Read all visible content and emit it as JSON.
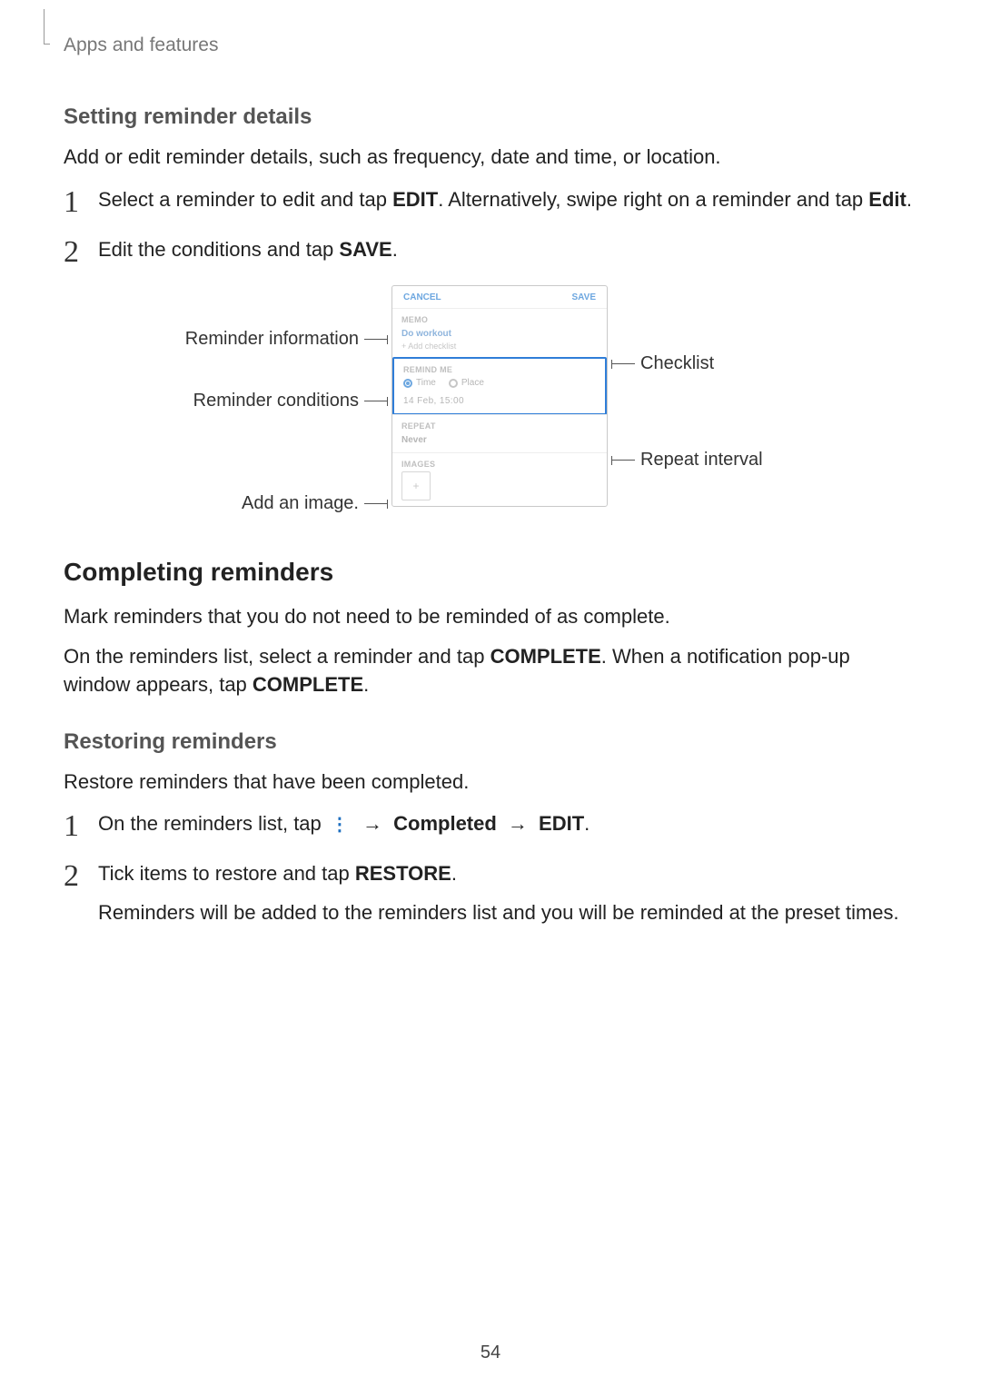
{
  "runningHead": "Apps and features",
  "pageNumber": "54",
  "s1": {
    "heading": "Setting reminder details",
    "intro": "Add or edit reminder details, such as frequency, date and time, or location.",
    "step1_a": "Select a reminder to edit and tap ",
    "step1_b": "EDIT",
    "step1_c": ". Alternatively, swipe right on a reminder and tap ",
    "step1_d": "Edit",
    "step1_e": ".",
    "step2_a": "Edit the conditions and tap ",
    "step2_b": "SAVE",
    "step2_c": "."
  },
  "fig": {
    "left1": "Reminder information",
    "left2": "Reminder conditions",
    "left3": "Add an image.",
    "right1": "Checklist",
    "right2": "Repeat interval",
    "phone": {
      "cancel": "CANCEL",
      "save": "SAVE",
      "memoLbl": "MEMO",
      "memo1": "Do workout",
      "memo2": "+  Add checklist",
      "condLbl": "REMIND ME",
      "radioTime": "Time",
      "radioPlace": "Place",
      "date": "14 Feb, 15:00",
      "repLbl": "REPEAT",
      "repVal": "Never",
      "imgLbl": "IMAGES"
    }
  },
  "s2": {
    "heading": "Completing reminders",
    "p1": "Mark reminders that you do not need to be reminded of as complete.",
    "p2_a": "On the reminders list, select a reminder and tap ",
    "p2_b": "COMPLETE",
    "p2_c": ". When a notification pop-up window appears, tap ",
    "p2_d": "COMPLETE",
    "p2_e": "."
  },
  "s3": {
    "heading": "Restoring reminders",
    "p1": "Restore reminders that have been completed.",
    "step1_a": "On the reminders list, tap ",
    "step1_arrow1": " → ",
    "step1_b": "Completed",
    "step1_arrow2": " → ",
    "step1_c": "EDIT",
    "step1_d": ".",
    "step2_a": "Tick items to restore and tap ",
    "step2_b": "RESTORE",
    "step2_c": ".",
    "step2_p": "Reminders will be added to the reminders list and you will be reminded at the preset times."
  }
}
